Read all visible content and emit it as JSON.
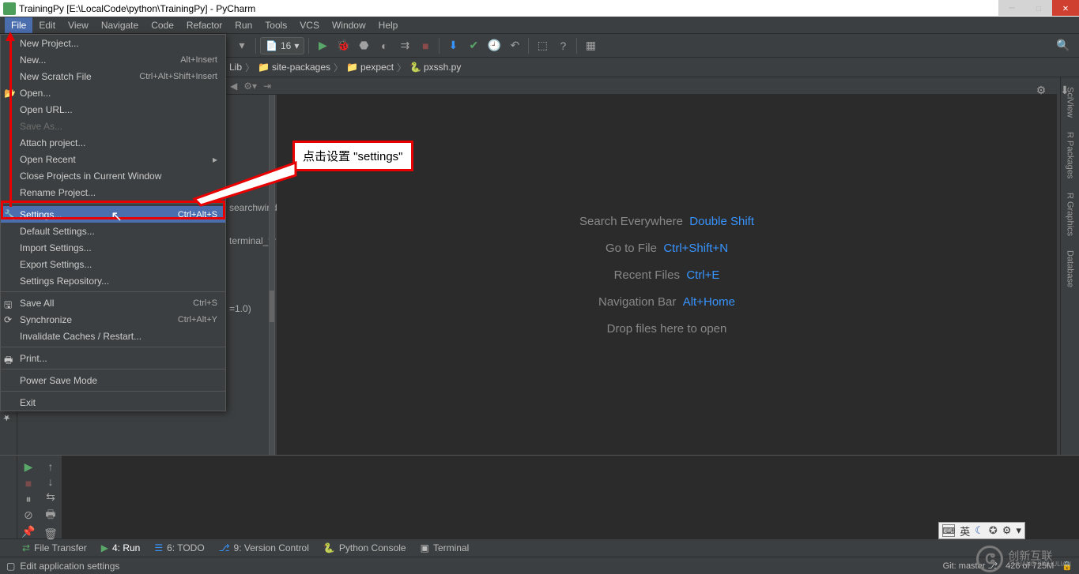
{
  "window": {
    "title": "TrainingPy [E:\\LocalCode\\python\\TrainingPy] - PyCharm"
  },
  "menubar": [
    "File",
    "Edit",
    "View",
    "Navigate",
    "Code",
    "Refactor",
    "Run",
    "Tools",
    "VCS",
    "Window",
    "Help"
  ],
  "toolbar": {
    "run_config": "16"
  },
  "breadcrumb": [
    "Lib",
    "site-packages",
    "pexpect",
    "pxssh.py"
  ],
  "dropdown": {
    "items": [
      {
        "label": "New Project..."
      },
      {
        "label": "New...",
        "shortcut": "Alt+Insert"
      },
      {
        "label": "New Scratch File",
        "shortcut": "Ctrl+Alt+Shift+Insert"
      },
      {
        "label": "Open...",
        "icon": "folder"
      },
      {
        "label": "Open URL..."
      },
      {
        "label": "Save As...",
        "disabled": true
      },
      {
        "label": "Attach project..."
      },
      {
        "label": "Open Recent",
        "submenu": true
      },
      {
        "label": "Close Projects in Current Window"
      },
      {
        "label": "Rename Project..."
      },
      {
        "sep": true
      },
      {
        "label": "Settings...",
        "shortcut": "Ctrl+Alt+S",
        "hl": true,
        "icon": "wrench"
      },
      {
        "label": "Default Settings..."
      },
      {
        "label": "Import Settings..."
      },
      {
        "label": "Export Settings..."
      },
      {
        "label": "Settings Repository..."
      },
      {
        "sep": true
      },
      {
        "label": "Save All",
        "shortcut": "Ctrl+S",
        "icon": "save"
      },
      {
        "label": "Synchronize",
        "shortcut": "Ctrl+Alt+Y",
        "icon": "sync"
      },
      {
        "label": "Invalidate Caches / Restart..."
      },
      {
        "sep": true
      },
      {
        "label": "Print...",
        "icon": "print"
      },
      {
        "sep": true
      },
      {
        "label": "Power Save Mode"
      },
      {
        "sep": true
      },
      {
        "label": "Exit"
      }
    ]
  },
  "quick": {
    "rows": [
      {
        "label": "Search Everywhere",
        "kb": "Double Shift"
      },
      {
        "label": "Go to File",
        "kb": "Ctrl+Shift+N"
      },
      {
        "label": "Recent Files",
        "kb": "Ctrl+E"
      },
      {
        "label": "Navigation Bar",
        "kb": "Alt+Home"
      },
      {
        "label": "Drop files here to open",
        "kb": ""
      }
    ]
  },
  "proj_lines": [
    "searchwindo",
    "terminal_ty",
    "=1.0)"
  ],
  "right_tabs": [
    "SciView",
    "R Packages",
    "R Graphics",
    "Database"
  ],
  "left_tab": "2: Favorites",
  "bottom_tabs": [
    {
      "icon": "transfer",
      "label": "File Transfer"
    },
    {
      "icon": "run",
      "label": "4: Run",
      "active": true
    },
    {
      "icon": "todo",
      "label": "6: TODO"
    },
    {
      "icon": "vcs",
      "label": "9: Version Control"
    },
    {
      "icon": "python",
      "label": "Python Console"
    },
    {
      "icon": "terminal",
      "label": "Terminal"
    }
  ],
  "statusbar": {
    "left": "Edit application settings",
    "git": "Git: master",
    "mem": "426 of 725M"
  },
  "callout": "点击设置 \"settings\"",
  "ime": {
    "kb": "⌨",
    "lang": "英",
    "moon": "☾",
    "sym": "✪"
  },
  "watermark": {
    "top": "创新互联",
    "bottom": "CHUANG XINHULIAN"
  }
}
